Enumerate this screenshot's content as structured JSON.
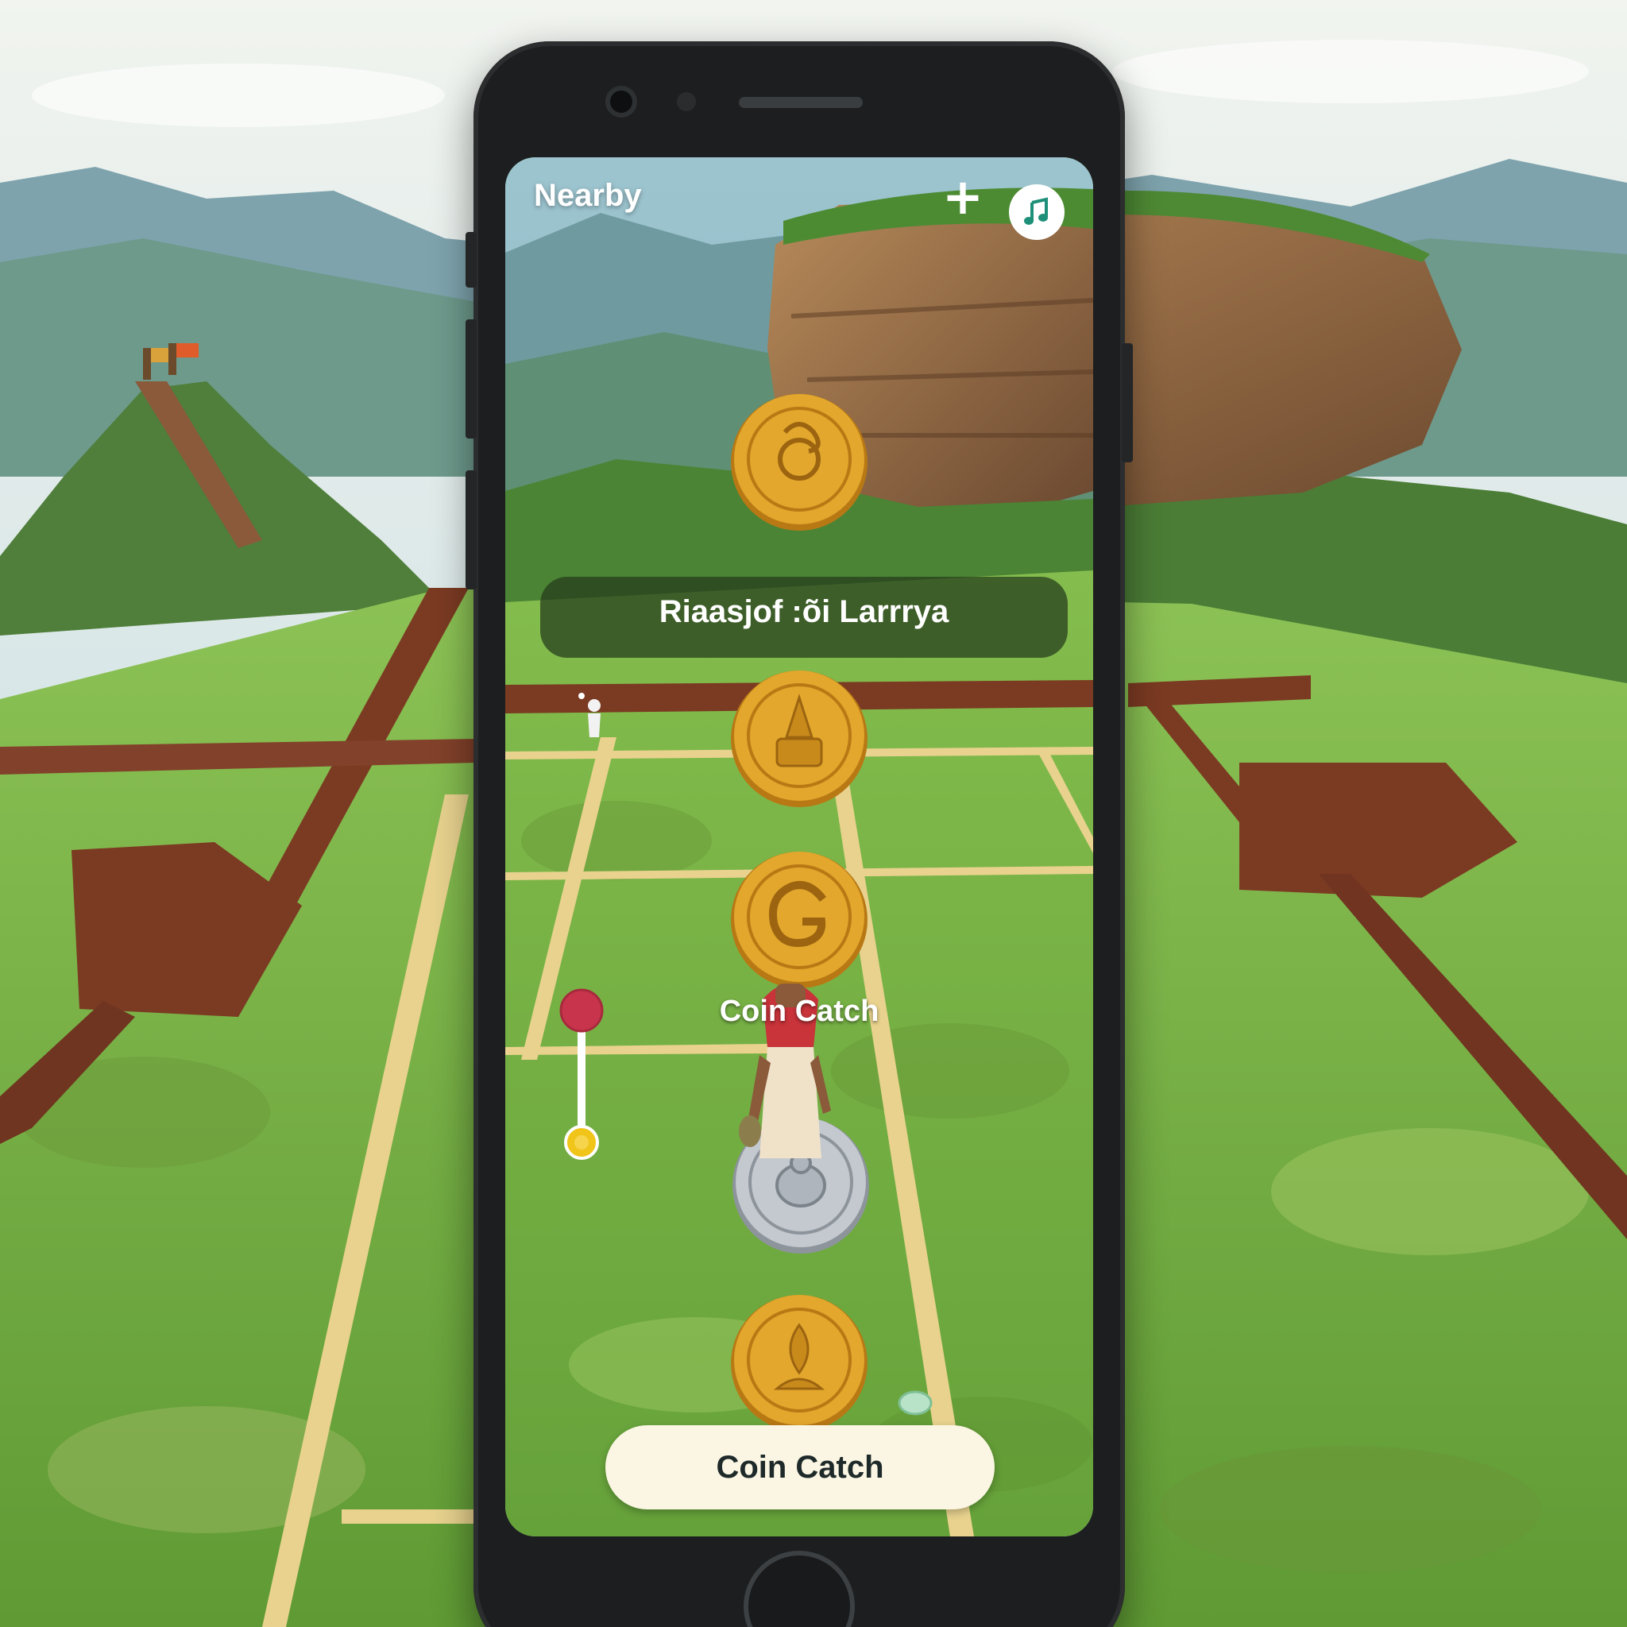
{
  "screen": {
    "header_title": "Nearby",
    "add_icon": "plus-icon",
    "music_icon": "music-note-icon",
    "location_banner": "Riaasjof :õi Larrrya",
    "avatar_label": "Coin Catch",
    "action_button": "Coin Catch"
  },
  "coins": [
    {
      "metal": "gold",
      "emblem": "swirl"
    },
    {
      "metal": "gold",
      "emblem": "stupa"
    },
    {
      "metal": "gold",
      "emblem": "spiral-g"
    },
    {
      "metal": "silver",
      "emblem": "figure"
    },
    {
      "metal": "gold",
      "emblem": "lotus"
    }
  ],
  "colors": {
    "gold": "#e2a72c",
    "gold_dark": "#b87915",
    "silver": "#c4c9cf",
    "silver_dark": "#8d949b",
    "grass": "#7fb84a",
    "path": "#e8d28e",
    "wall": "#7b3a22",
    "pin": "#c8344b",
    "pin_base": "#f0c419",
    "button_bg": "#fbf6e3"
  }
}
